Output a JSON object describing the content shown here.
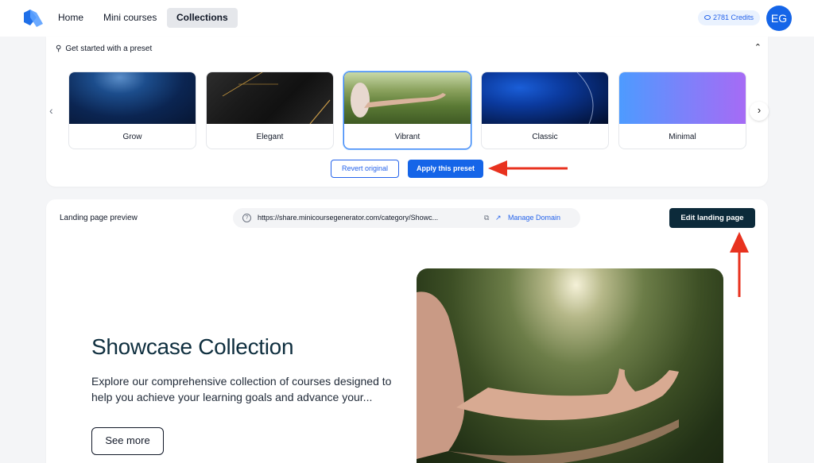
{
  "nav": {
    "home": "Home",
    "mini_courses": "Mini courses",
    "collections": "Collections",
    "credits": "2781 Credits",
    "avatar_initials": "EG"
  },
  "preset_section": {
    "header": "Get started with a preset",
    "presets": [
      {
        "label": "Grow",
        "selected": false
      },
      {
        "label": "Elegant",
        "selected": false
      },
      {
        "label": "Vibrant",
        "selected": true
      },
      {
        "label": "Classic",
        "selected": false
      },
      {
        "label": "Minimal",
        "selected": false
      }
    ],
    "revert_label": "Revert original",
    "apply_label": "Apply this preset"
  },
  "landing": {
    "title": "Landing page preview",
    "url": "https://share.minicoursegenerator.com/category/Showc...",
    "manage_domain": "Manage Domain",
    "edit_label": "Edit landing page",
    "hero_title": "Showcase Collection",
    "hero_description": "Explore our comprehensive collection of courses designed to help you achieve your learning goals and advance your...",
    "hero_button": "See more"
  },
  "colors": {
    "accent": "#1565e8",
    "dark_button": "#0c2a3a",
    "annotation": "#e8321f"
  }
}
